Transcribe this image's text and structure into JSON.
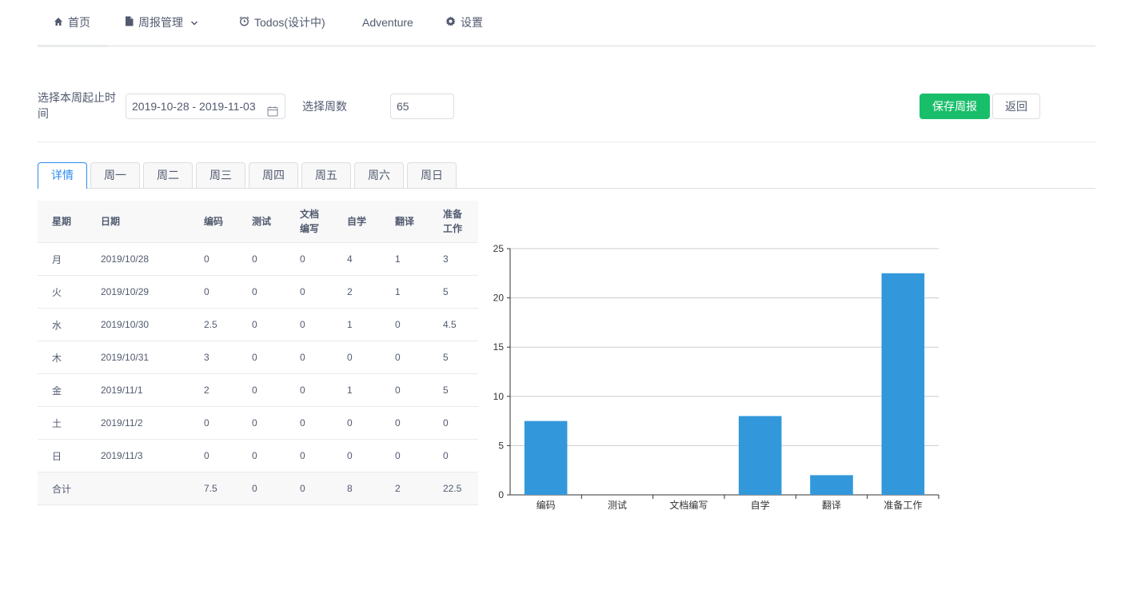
{
  "nav": {
    "items": [
      {
        "label": "首页",
        "icon": "home-icon"
      },
      {
        "label": "周报管理",
        "icon": "document-icon",
        "has_dropdown": true
      },
      {
        "label": "Todos(设计中)",
        "icon": "alarm-clock-icon"
      },
      {
        "label": "Adventure",
        "icon": ""
      },
      {
        "label": "设置",
        "icon": "gear-icon"
      }
    ],
    "active_index": 0
  },
  "form": {
    "date_label": "选择本周起止时间",
    "date_label_line1": "选择本周起止时",
    "date_label_line2": "间",
    "date_range_value": "2019-10-28 - 2019-11-03",
    "week_label": "选择周数",
    "week_value": "65",
    "save_label": "保存周报",
    "back_label": "返回"
  },
  "tabs": [
    {
      "label": "详情",
      "active": true
    },
    {
      "label": "周一",
      "active": false
    },
    {
      "label": "周二",
      "active": false
    },
    {
      "label": "周三",
      "active": false
    },
    {
      "label": "周四",
      "active": false
    },
    {
      "label": "周五",
      "active": false
    },
    {
      "label": "周六",
      "active": false
    },
    {
      "label": "周日",
      "active": false
    }
  ],
  "table": {
    "headers": [
      "星期",
      "日期",
      "编码",
      "测试",
      "文档编写",
      "自学",
      "翻译",
      "准备工作"
    ],
    "rows": [
      [
        "月",
        "2019/10/28",
        "0",
        "0",
        "0",
        "4",
        "1",
        "3"
      ],
      [
        "火",
        "2019/10/29",
        "0",
        "0",
        "0",
        "2",
        "1",
        "5"
      ],
      [
        "水",
        "2019/10/30",
        "2.5",
        "0",
        "0",
        "1",
        "0",
        "4.5"
      ],
      [
        "木",
        "2019/10/31",
        "3",
        "0",
        "0",
        "0",
        "0",
        "5"
      ],
      [
        "金",
        "2019/11/1",
        "2",
        "0",
        "0",
        "1",
        "0",
        "5"
      ],
      [
        "土",
        "2019/11/2",
        "0",
        "0",
        "0",
        "0",
        "0",
        "0"
      ],
      [
        "日",
        "2019/11/3",
        "0",
        "0",
        "0",
        "0",
        "0",
        "0"
      ]
    ],
    "total": [
      "合计",
      "",
      "7.5",
      "0",
      "0",
      "8",
      "2",
      "22.5"
    ]
  },
  "chart_data": {
    "type": "bar",
    "categories": [
      "编码",
      "测试",
      "文档编写",
      "自学",
      "翻译",
      "准备工作"
    ],
    "values": [
      7.5,
      0,
      0,
      8,
      2,
      22.5
    ],
    "ylim": [
      0,
      25
    ],
    "yticks": [
      0,
      5,
      10,
      15,
      20,
      25
    ],
    "grid": true,
    "bar_color": "#3398DB",
    "title": "",
    "xlabel": "",
    "ylabel": ""
  },
  "colors": {
    "primary": "#2d8cf0",
    "success": "#19be6b",
    "border": "#dcdee2",
    "text": "#515a6e"
  }
}
